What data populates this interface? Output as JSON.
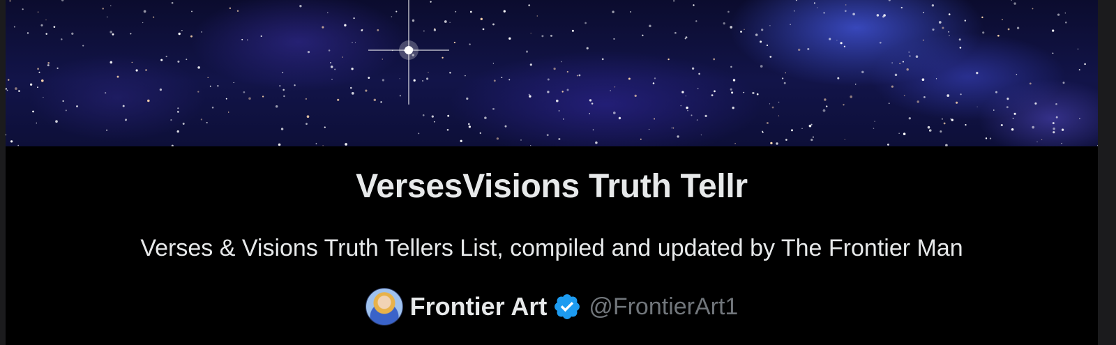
{
  "list": {
    "title": "VersesVisions Truth Tellr",
    "description": "Verses & Visions Truth Tellers List, compiled and updated by The Frontier Man",
    "banner_icon": "starfield-banner",
    "owner": {
      "name": "Frontier Art",
      "handle": "@FrontierArt1",
      "avatar_icon": "profile-avatar",
      "verified_icon": "verified-badge-icon",
      "verified": true
    }
  },
  "colors": {
    "background": "#000000",
    "text_primary": "#e7e9ea",
    "text_secondary": "#71767b",
    "verified_blue": "#1d9bf0"
  }
}
